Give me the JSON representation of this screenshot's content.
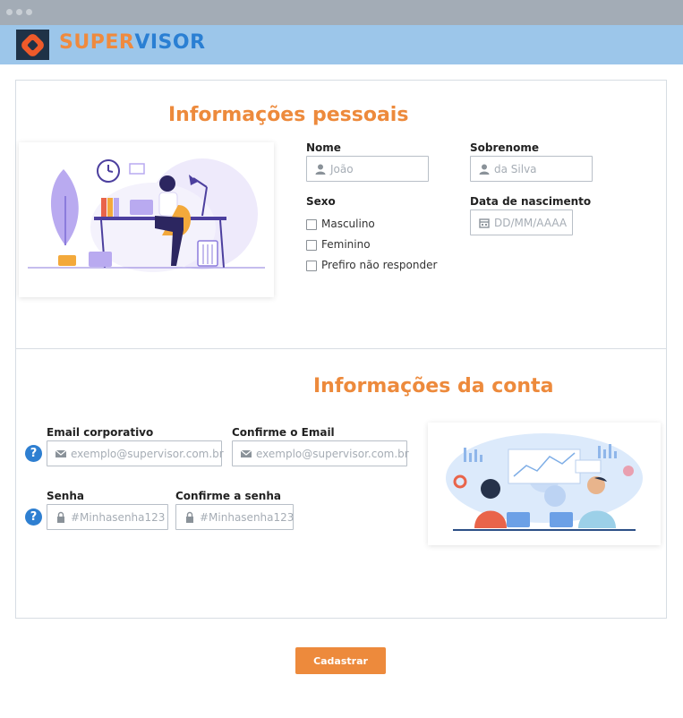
{
  "app": {
    "brand_part1": "SUPER",
    "brand_part2": "VISOR"
  },
  "personal": {
    "title": "Informações pessoais",
    "first_name": {
      "label": "Nome",
      "placeholder": "João",
      "icon": "user-icon"
    },
    "last_name": {
      "label": "Sobrenome",
      "placeholder": "da Silva",
      "icon": "user-icon"
    },
    "sex": {
      "label": "Sexo",
      "options": [
        "Masculino",
        "Feminino",
        "Prefiro não responder"
      ]
    },
    "birth_date": {
      "label": "Data de nascimento",
      "placeholder": "DD/MM/AAAA",
      "icon": "calendar-icon"
    }
  },
  "account": {
    "title": "Informações da conta",
    "email": {
      "label": "Email corporativo",
      "placeholder": "exemplo@supervisor.com.br",
      "icon": "mail-icon"
    },
    "email_confirm": {
      "label": "Confirme o Email",
      "placeholder": "exemplo@supervisor.com.br",
      "icon": "mail-icon"
    },
    "password": {
      "label": "Senha",
      "placeholder": "#Minhasenha123",
      "icon": "lock-icon"
    },
    "password_confirm": {
      "label": "Confirme a senha",
      "placeholder": "#Minhasenha123",
      "icon": "lock-icon"
    },
    "help_glyph": "?"
  },
  "submit_label": "Cadastrar",
  "colors": {
    "accent": "#ed8a3c",
    "brand_blue": "#2a7fd3",
    "header_bg": "#9cc6ea",
    "help_blue": "#2e7fd1"
  }
}
